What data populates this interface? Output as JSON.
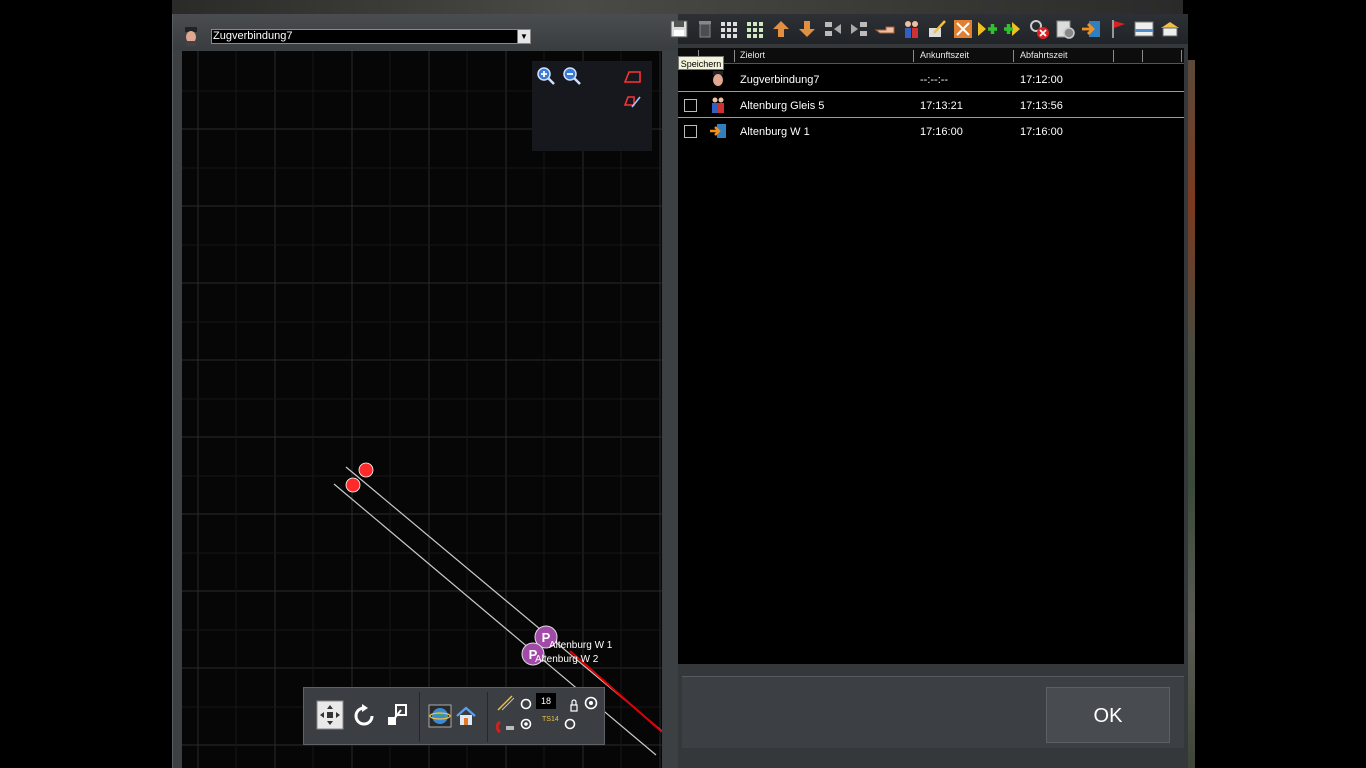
{
  "train": {
    "selected": "Zugverbindung7"
  },
  "toolbar": {
    "tooltip": "Speichern",
    "tools": [
      "save-icon",
      "trash-icon",
      "grid-small-icon",
      "grid-green-icon",
      "move-up-icon",
      "move-down-icon",
      "insert-before-icon",
      "insert-after-icon",
      "hand-icon",
      "passengers-icon",
      "edit-icon",
      "waypoint-icon",
      "add-green-icon",
      "add-arrow-icon",
      "remove-icon",
      "settings-icon",
      "exit-icon",
      "flag-icon",
      "keyboard-icon",
      "station-icon"
    ]
  },
  "schedule": {
    "columns": {
      "destination": "Zielort",
      "arrival": "Ankunftszeit",
      "departure": "Abfahrtszeit"
    },
    "rows": [
      {
        "icon": "driver-icon",
        "destination": "Zugverbindung7",
        "arrival": "--:--:--",
        "departure": "17:12:00",
        "checkbox": false
      },
      {
        "icon": "passengers-icon",
        "destination": "Altenburg Gleis 5",
        "arrival": "17:13:21",
        "departure": "17:13:56",
        "checkbox": true
      },
      {
        "icon": "exit-icon",
        "destination": "Altenburg W 1",
        "arrival": "17:16:00",
        "departure": "17:16:00",
        "checkbox": true
      }
    ]
  },
  "map": {
    "stations": [
      "Altenburg W 1",
      "Altenburg W 2"
    ],
    "speed_value": "18",
    "ts_label": "TS14"
  },
  "actions": {
    "ok": "OK"
  },
  "colors": {
    "signal": "#ff2a2a",
    "station_marker": "#a24aa8",
    "route_line": "#e00000"
  }
}
